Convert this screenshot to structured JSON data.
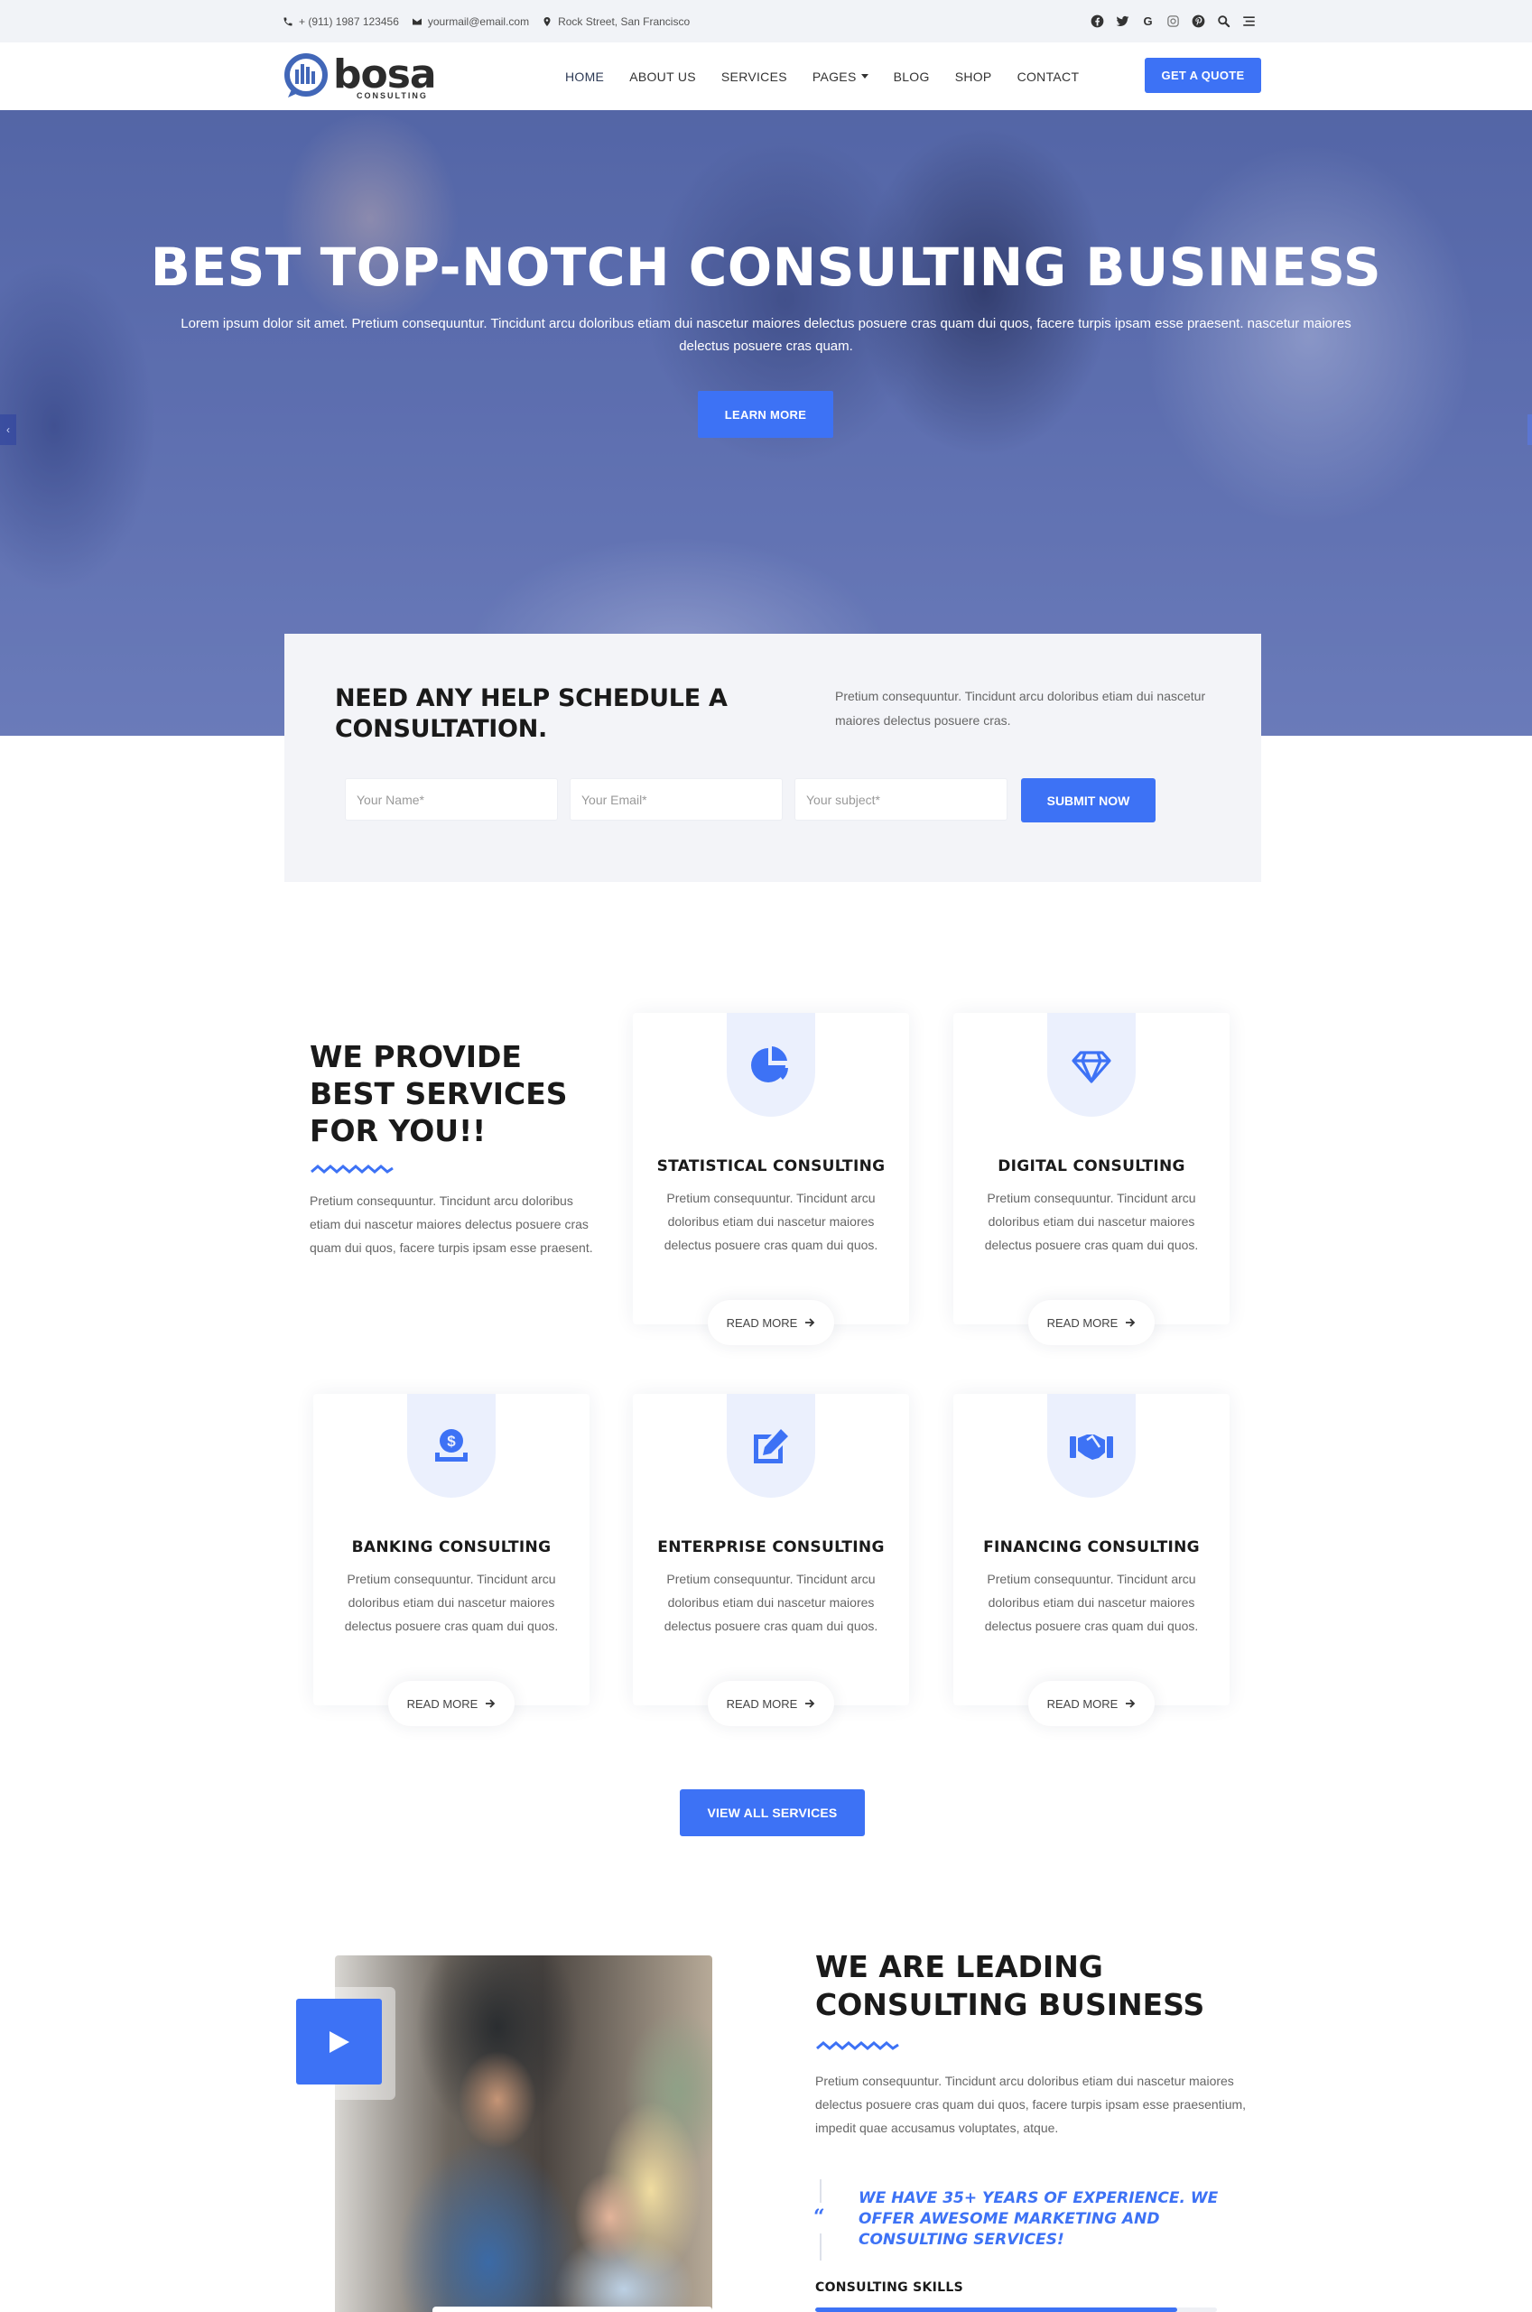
{
  "topbar": {
    "phone": "+ (911) 1987 123456",
    "email": "yourmail@email.com",
    "address": "Rock Street, San Francisco",
    "social_icons": [
      "facebook-icon",
      "twitter-icon",
      "google-icon",
      "instagram-icon",
      "pinterest-icon",
      "search-icon",
      "menu-icon"
    ]
  },
  "nav": {
    "logo_word": "bosa",
    "logo_tagline": "CONSULTING",
    "links": [
      {
        "label": "HOME",
        "active": true
      },
      {
        "label": "ABOUT US"
      },
      {
        "label": "SERVICES"
      },
      {
        "label": "PAGES",
        "dropdown": true
      },
      {
        "label": "BLOG"
      },
      {
        "label": "SHOP"
      },
      {
        "label": "CONTACT"
      }
    ],
    "cta_label": "GET A QUOTE"
  },
  "hero": {
    "title": "BEST TOP-NOTCH CONSULTING BUSINESS",
    "subtitle": "Lorem ipsum dolor sit amet. Pretium consequuntur. Tincidunt arcu doloribus etiam dui nascetur maiores delectus posuere cras quam dui quos, facere turpis ipsam esse praesent. nascetur maiores delectus posuere cras quam.",
    "button_label": "LEARN MORE",
    "prev_arrow": "‹"
  },
  "consultation": {
    "title": "NEED ANY HELP SCHEDULE A CONSULTATION.",
    "description": "Pretium consequuntur. Tincidunt arcu doloribus etiam dui nascetur maiores delectus posuere cras.",
    "fields": {
      "name_placeholder": "Your Name*",
      "email_placeholder": "Your Email*",
      "subject_placeholder": "Your subject*"
    },
    "submit_label": "SUBMIT NOW"
  },
  "services": {
    "title": "WE PROVIDE BEST SERVICES FOR YOU!!",
    "description": "Pretium consequuntur. Tincidunt arcu doloribus etiam dui nascetur maiores delectus posuere cras quam dui quos, facere turpis ipsam esse praesent.",
    "cards": [
      {
        "title": "STATISTICAL CONSULTING",
        "icon": "pie-chart-icon",
        "text": "Pretium consequuntur. Tincidunt arcu doloribus etiam dui nascetur maiores delectus posuere cras quam dui quos.",
        "link": "READ MORE"
      },
      {
        "title": "DIGITAL CONSULTING",
        "icon": "diamond-icon",
        "text": "Pretium consequuntur. Tincidunt arcu doloribus etiam dui nascetur maiores delectus posuere cras quam dui quos.",
        "link": "READ MORE"
      },
      {
        "title": "BANKING CONSULTING",
        "icon": "dollar-deposit-icon",
        "text": "Pretium consequuntur. Tincidunt arcu doloribus etiam dui nascetur maiores delectus posuere cras quam dui quos.",
        "link": "READ MORE"
      },
      {
        "title": "ENTERPRISE CONSULTING",
        "icon": "edit-icon",
        "text": "Pretium consequuntur. Tincidunt arcu doloribus etiam dui nascetur maiores delectus posuere cras quam dui quos.",
        "link": "READ MORE"
      },
      {
        "title": "FINANCING CONSULTING",
        "icon": "handshake-icon",
        "text": "Pretium consequuntur. Tincidunt arcu doloribus etiam dui nascetur maiores delectus posuere cras quam dui quos.",
        "link": "READ MORE"
      }
    ],
    "view_all_label": "VIEW ALL SERVICES"
  },
  "about": {
    "title": "WE ARE LEADING CONSULTING BUSINESS",
    "description": "Pretium consequuntur. Tincidunt arcu doloribus etiam dui nascetur maiores delectus posuere cras quam dui quos, facere turpis ipsam esse praesentium, impedit quae accusamus voluptates, atque.",
    "quote_mark": "“",
    "quote": "WE HAVE 35+ YEARS OF EXPERIENCE. WE OFFER AWESOME MARKETING AND CONSULTING SERVICES!",
    "skills_label": "CONSULTING SKILLS",
    "skills_progress_percent": 90
  },
  "colors": {
    "accent": "#3d72f5",
    "badge_bg": "#ebf0fd",
    "topbar_bg": "#f1f3f7",
    "consult_bg": "#f3f4f8",
    "heading": "#1a1a1a",
    "body_text": "#666666"
  }
}
